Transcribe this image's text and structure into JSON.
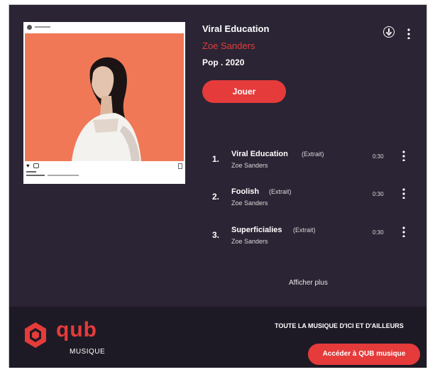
{
  "album": {
    "title": "Viral Education",
    "artist": "Zoe Sanders",
    "meta": "Pop . 2020"
  },
  "colors": {
    "background": "#2b2434",
    "accent": "#e53b3b",
    "cover_art": "#f07857",
    "footer": "#1e1a25"
  },
  "actions": {
    "play_label": "Jouer",
    "download_icon": "download-icon",
    "more_icon": "kebab-menu-icon"
  },
  "tracks": [
    {
      "number": "1.",
      "name": "Viral Education",
      "tag": "(Extrait)",
      "artist": "Zoe Sanders",
      "duration": "0:30"
    },
    {
      "number": "2.",
      "name": "Foolish",
      "tag": "(Extrait)",
      "artist": "Zoe Sanders",
      "duration": "0:30"
    },
    {
      "number": "3.",
      "name": "Superficialies",
      "tag": "(Extrait)",
      "artist": "Zoe Sanders",
      "duration": "0:30"
    }
  ],
  "more_label": "Afficher plus",
  "footer": {
    "logo_text": "qub",
    "logo_sub": "MUSIQUE",
    "tagline": "TOUTE LA MUSIQUE D'ICI ET D'AILLEURS",
    "cta_label": "Accéder à QUB musique"
  }
}
